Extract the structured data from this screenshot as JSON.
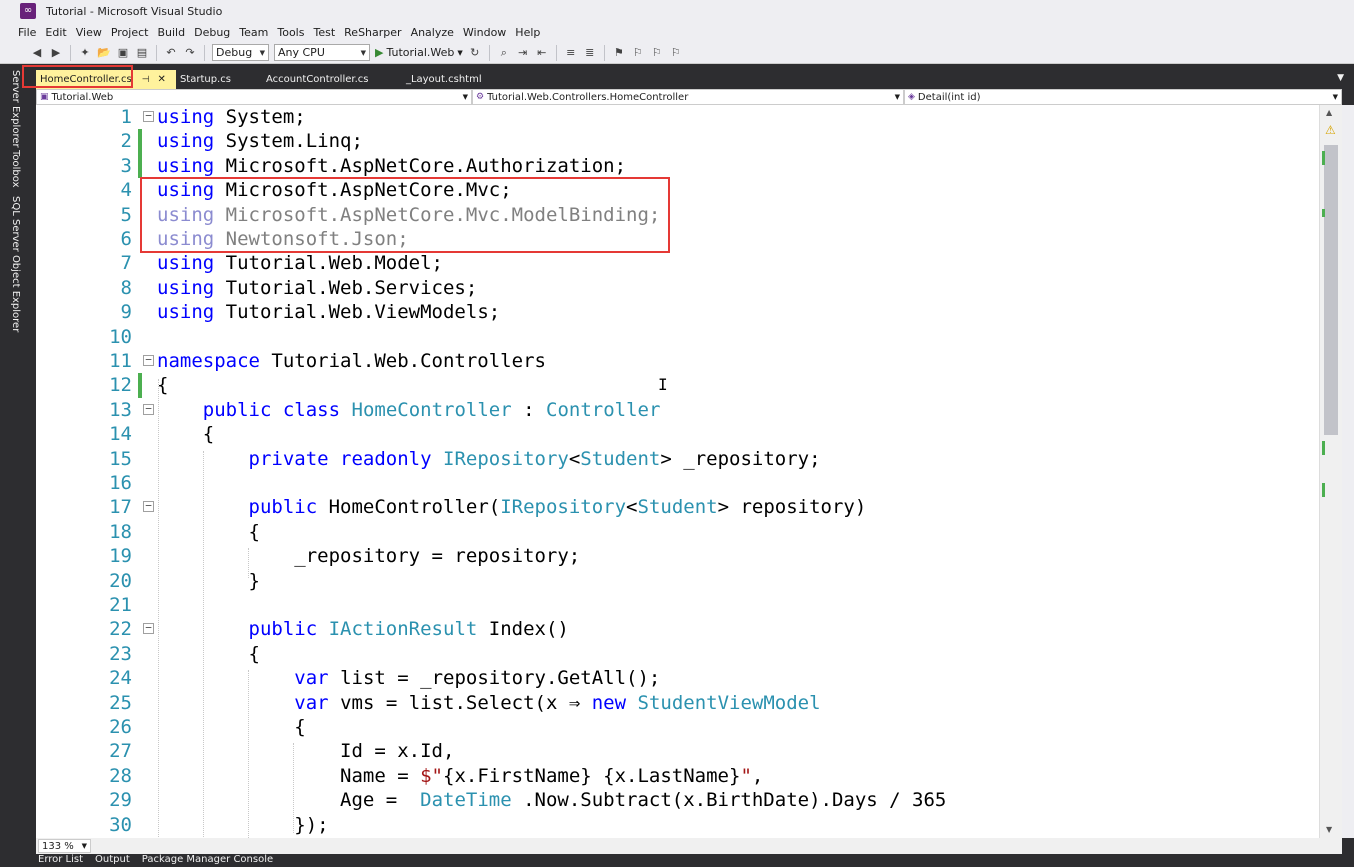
{
  "window": {
    "title": "Tutorial - Microsoft Visual Studio"
  },
  "menu": [
    "File",
    "Edit",
    "View",
    "Project",
    "Build",
    "Debug",
    "Team",
    "Tools",
    "Test",
    "ReSharper",
    "Analyze",
    "Window",
    "Help"
  ],
  "toolbar": {
    "config": "Debug",
    "platform": "Any CPU",
    "start_label": "Tutorial.Web"
  },
  "side_tabs": [
    "Server Explorer",
    "Toolbox",
    "SQL Server Object Explorer"
  ],
  "tabs": [
    {
      "label": "HomeController.cs",
      "active": true
    },
    {
      "label": "Startup.cs",
      "active": false
    },
    {
      "label": "AccountController.cs",
      "active": false
    },
    {
      "label": "_Layout.cshtml",
      "active": false
    }
  ],
  "navbar": {
    "project": "Tutorial.Web",
    "type": "Tutorial.Web.Controllers.HomeController",
    "member": "Detail(int id)"
  },
  "code_lines": [
    {
      "n": "1",
      "tokens": [
        [
          "kw",
          "using"
        ],
        [
          "",
          "System;"
        ]
      ]
    },
    {
      "n": "2",
      "tokens": [
        [
          "kw",
          "using"
        ],
        [
          "",
          "System.Linq;"
        ]
      ]
    },
    {
      "n": "3",
      "tokens": [
        [
          "kw",
          "using"
        ],
        [
          "",
          "Microsoft.AspNetCore.Authorization;"
        ]
      ]
    },
    {
      "n": "4",
      "tokens": [
        [
          "kw",
          "using"
        ],
        [
          "",
          "Microsoft.AspNetCore.Mvc;"
        ]
      ]
    },
    {
      "n": "5",
      "tokens": [
        [
          "dimkw",
          "using"
        ],
        [
          "dim",
          "Microsoft.AspNetCore.Mvc.ModelBinding;"
        ]
      ]
    },
    {
      "n": "6",
      "tokens": [
        [
          "dimkw",
          "using"
        ],
        [
          "dim",
          "Newtonsoft.Json;"
        ]
      ]
    },
    {
      "n": "7",
      "tokens": [
        [
          "kw",
          "using"
        ],
        [
          "",
          "Tutorial.Web.Model;"
        ]
      ]
    },
    {
      "n": "8",
      "tokens": [
        [
          "kw",
          "using"
        ],
        [
          "",
          "Tutorial.Web.Services;"
        ]
      ]
    },
    {
      "n": "9",
      "tokens": [
        [
          "kw",
          "using"
        ],
        [
          "",
          "Tutorial.Web.ViewModels;"
        ]
      ]
    },
    {
      "n": "10",
      "tokens": []
    },
    {
      "n": "11",
      "tokens": [
        [
          "kw",
          "namespace"
        ],
        [
          "",
          "Tutorial.Web.Controllers"
        ]
      ]
    },
    {
      "n": "12",
      "tokens": [
        [
          "",
          "{"
        ]
      ]
    },
    {
      "n": "13",
      "tokens": [
        [
          "",
          "    "
        ],
        [
          "kw",
          "public class"
        ],
        [
          "ty",
          "HomeController"
        ],
        [
          "",
          ":"
        ],
        [
          "ty",
          "Controller"
        ]
      ]
    },
    {
      "n": "14",
      "tokens": [
        [
          "",
          "    {"
        ]
      ]
    },
    {
      "n": "15",
      "tokens": [
        [
          "",
          "        "
        ],
        [
          "kw",
          "private readonly"
        ],
        [
          "ty",
          "IRepository"
        ],
        [
          "",
          "<"
        ],
        [
          "ty",
          "Student"
        ],
        [
          "",
          "> _repository;"
        ]
      ]
    },
    {
      "n": "16",
      "tokens": []
    },
    {
      "n": "17",
      "tokens": [
        [
          "",
          "        "
        ],
        [
          "kw",
          "public"
        ],
        [
          "",
          "HomeController("
        ],
        [
          "ty",
          "IRepository"
        ],
        [
          "",
          "<"
        ],
        [
          "ty",
          "Student"
        ],
        [
          "",
          "> repository)"
        ]
      ]
    },
    {
      "n": "18",
      "tokens": [
        [
          "",
          "        {"
        ]
      ]
    },
    {
      "n": "19",
      "tokens": [
        [
          "",
          "            _repository = repository;"
        ]
      ]
    },
    {
      "n": "20",
      "tokens": [
        [
          "",
          "        }"
        ]
      ]
    },
    {
      "n": "21",
      "tokens": []
    },
    {
      "n": "22",
      "tokens": [
        [
          "",
          "        "
        ],
        [
          "kw",
          "public"
        ],
        [
          "ty",
          "IActionResult"
        ],
        [
          "",
          "Index()"
        ]
      ]
    },
    {
      "n": "23",
      "tokens": [
        [
          "",
          "        {"
        ]
      ]
    },
    {
      "n": "24",
      "tokens": [
        [
          "",
          "            "
        ],
        [
          "kw",
          "var"
        ],
        [
          "",
          "list = _repository.GetAll();"
        ]
      ]
    },
    {
      "n": "25",
      "tokens": [
        [
          "",
          "            "
        ],
        [
          "kw",
          "var"
        ],
        [
          "",
          "vms = list.Select(x ⇒"
        ],
        [
          "kw",
          "new"
        ],
        [
          "ty",
          "StudentViewModel"
        ]
      ]
    },
    {
      "n": "26",
      "tokens": [
        [
          "",
          "            {"
        ]
      ]
    },
    {
      "n": "27",
      "tokens": [
        [
          "",
          "                Id = x.Id,"
        ]
      ]
    },
    {
      "n": "28",
      "tokens": [
        [
          "",
          "                Name = "
        ],
        [
          "str",
          "$\""
        ],
        [
          "",
          "{x.FirstName}"
        ],
        [
          "str",
          " "
        ],
        [
          "",
          "{x.LastName}"
        ],
        [
          "str",
          "\""
        ],
        [
          "",
          ","
        ]
      ]
    },
    {
      "n": "29",
      "tokens": [
        [
          "",
          "                Age = "
        ],
        [
          "ty",
          "DateTime"
        ],
        [
          "",
          ".Now.Subtract(x.BirthDate).Days / 365"
        ]
      ]
    },
    {
      "n": "30",
      "tokens": [
        [
          "",
          "            });"
        ]
      ]
    }
  ],
  "folds": [
    "1",
    "11",
    "13",
    "17",
    "22"
  ],
  "changed_lines": [
    "2",
    "3",
    "12"
  ],
  "zoom": "133 %",
  "bottom_tabs": [
    "Error List",
    "Output",
    "Package Manager Console"
  ]
}
